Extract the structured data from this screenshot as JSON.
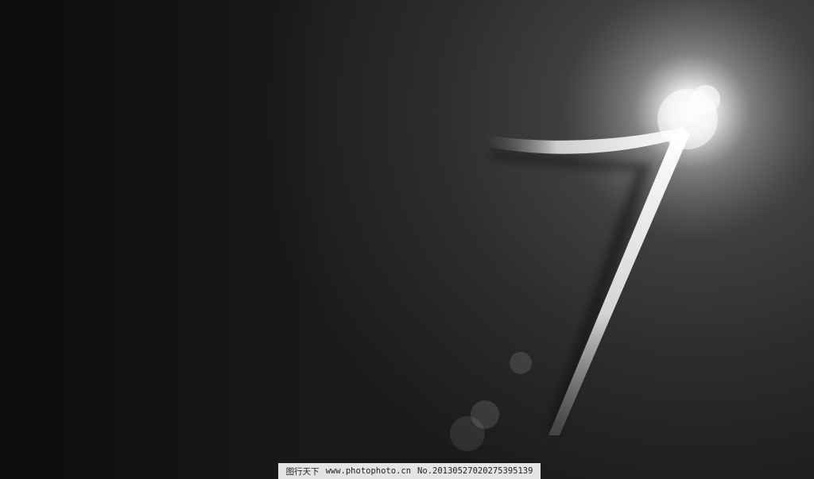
{
  "wallpaper": {
    "numeral": "7",
    "background_color": "#1b1b1b",
    "glow_color": "#ffffff",
    "stroke_color": "#e8e8e8"
  },
  "watermark": {
    "site_name": "图行天下",
    "site_url": "www.photophoto.cn",
    "image_number": "No.20130527020275395139"
  }
}
